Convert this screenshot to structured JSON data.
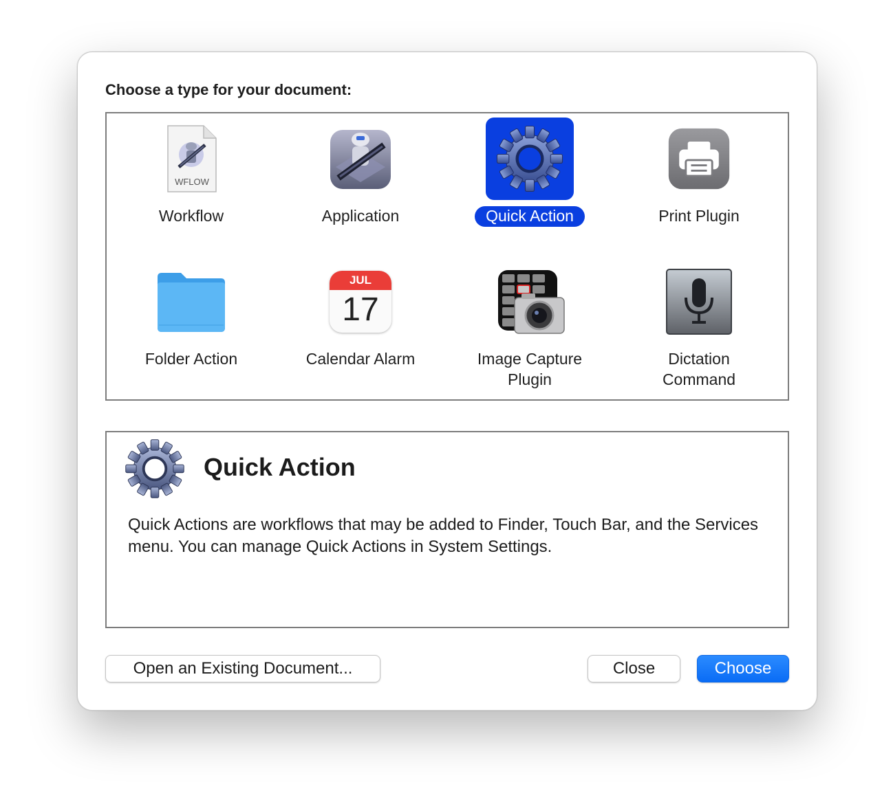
{
  "dialog": {
    "heading": "Choose a type for your document:"
  },
  "types": [
    {
      "label": "Workflow",
      "icon": "workflow-file-icon",
      "badge": "WFLOW"
    },
    {
      "label": "Application",
      "icon": "automator-robot-icon"
    },
    {
      "label": "Quick Action",
      "icon": "gear-icon",
      "selected": true
    },
    {
      "label": "Print Plugin",
      "icon": "printer-icon"
    },
    {
      "label": "Folder Action",
      "icon": "folder-icon"
    },
    {
      "label": "Calendar Alarm",
      "icon": "calendar-icon",
      "month": "JUL",
      "day": "17"
    },
    {
      "label_line1": "Image Capture",
      "label_line2": "Plugin",
      "icon": "camera-icon"
    },
    {
      "label_line1": "Dictation",
      "label_line2": "Command",
      "icon": "microphone-icon"
    }
  ],
  "description": {
    "title": "Quick Action",
    "text": "Quick Actions are workflows that may be added to Finder, Touch Bar, and the Services menu. You can manage Quick Actions in System Settings.",
    "icon": "gear-icon"
  },
  "buttons": {
    "open_existing": "Open an Existing Document...",
    "close": "Close",
    "choose": "Choose"
  },
  "colors": {
    "selection": "#0a3fe0",
    "primary_button": "#0a6cf5"
  }
}
